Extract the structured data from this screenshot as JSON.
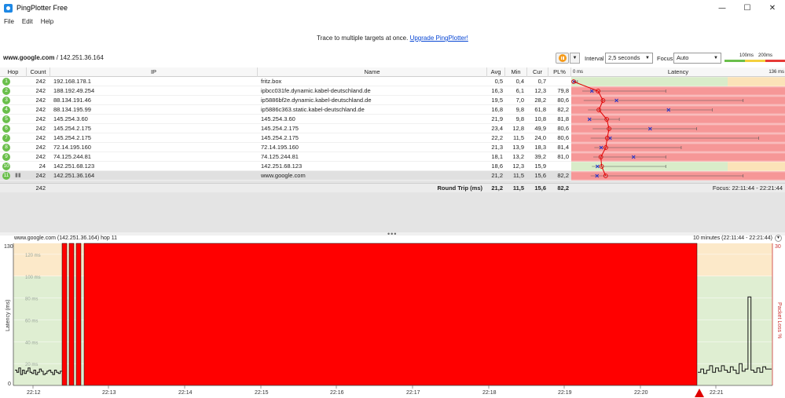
{
  "window": {
    "title": "PingPlotter Free",
    "minimize": "—",
    "maximize": "☐",
    "close": "✕"
  },
  "menu": [
    "File",
    "Edit",
    "Help"
  ],
  "banner": {
    "text": "Trace to multiple targets at once. ",
    "link": "Upgrade PingPlotter!"
  },
  "toolbar": {
    "target_host": "www.google.com",
    "target_ip": " / 142.251.36.164",
    "interval_label": "Interval",
    "interval_value": "2,5 seconds",
    "focus_label": "Focus",
    "focus_value": "Auto",
    "scale_100": "100ms",
    "scale_200": "200ms"
  },
  "colors": {
    "good": "#6abf4b",
    "warn": "#f4d03f",
    "bad": "#e53935",
    "loss_red": "#ff0000",
    "accent": "#f59b1c"
  },
  "table": {
    "headers": {
      "hop": "Hop",
      "count": "Count",
      "ip": "IP",
      "name": "Name",
      "avg": "Avg",
      "min": "Min",
      "cur": "Cur",
      "pl": "PL%",
      "latency": "Latency"
    },
    "latency_axis": {
      "start": "0 ms",
      "end": "136 ms",
      "max": 136
    },
    "rows": [
      {
        "hop": "1",
        "count": "242",
        "ip": "192.168.178.1",
        "name": "fritz.box",
        "avg": "0,5",
        "min": "0,4",
        "cur": "0,7",
        "pl": "",
        "avg_v": 0.5,
        "min_v": 0.4,
        "max_v": 3,
        "cur_v": 0.7,
        "pl_v": 0
      },
      {
        "hop": "2",
        "count": "242",
        "ip": "188.192.49.254",
        "name": "ipbcc031fe.dynamic.kabel-deutschland.de",
        "avg": "16,3",
        "min": "6,1",
        "cur": "12,3",
        "pl": "79,8",
        "avg_v": 16.3,
        "min_v": 6.1,
        "max_v": 60,
        "cur_v": 12.3,
        "pl_v": 79.8
      },
      {
        "hop": "3",
        "count": "242",
        "ip": "88.134.191.46",
        "name": "ip5886bf2e.dynamic.kabel-deutschland.de",
        "avg": "19,5",
        "min": "7,0",
        "cur": "28,2",
        "pl": "80,6",
        "avg_v": 19.5,
        "min_v": 7.0,
        "max_v": 110,
        "cur_v": 28.2,
        "pl_v": 80.6
      },
      {
        "hop": "4",
        "count": "242",
        "ip": "88.134.195.99",
        "name": "ip5886c363.static.kabel-deutschland.de",
        "avg": "16,8",
        "min": "9,8",
        "cur": "61,8",
        "pl": "82,2",
        "avg_v": 16.8,
        "min_v": 9.8,
        "max_v": 90,
        "cur_v": 61.8,
        "pl_v": 82.2
      },
      {
        "hop": "5",
        "count": "242",
        "ip": "145.254.3.60",
        "name": "145.254.3.60",
        "avg": "21,9",
        "min": "9,8",
        "cur": "10,8",
        "pl": "81,8",
        "avg_v": 21.9,
        "min_v": 9.8,
        "max_v": 30,
        "cur_v": 10.8,
        "pl_v": 81.8
      },
      {
        "hop": "6",
        "count": "242",
        "ip": "145.254.2.175",
        "name": "145.254.2.175",
        "avg": "23,4",
        "min": "12,8",
        "cur": "49,9",
        "pl": "80,6",
        "avg_v": 23.4,
        "min_v": 12.8,
        "max_v": 80,
        "cur_v": 49.9,
        "pl_v": 80.6
      },
      {
        "hop": "7",
        "count": "242",
        "ip": "145.254.2.175",
        "name": "145.254.2.175",
        "avg": "22,2",
        "min": "11,5",
        "cur": "24,0",
        "pl": "80,6",
        "avg_v": 22.2,
        "min_v": 11.5,
        "max_v": 120,
        "cur_v": 24.0,
        "pl_v": 80.6
      },
      {
        "hop": "8",
        "count": "242",
        "ip": "72.14.195.160",
        "name": "72.14.195.160",
        "avg": "21,3",
        "min": "13,9",
        "cur": "18,3",
        "pl": "81,4",
        "avg_v": 21.3,
        "min_v": 13.9,
        "max_v": 70,
        "cur_v": 18.3,
        "pl_v": 81.4
      },
      {
        "hop": "9",
        "count": "242",
        "ip": "74.125.244.81",
        "name": "74.125.244.81",
        "avg": "18,1",
        "min": "13,2",
        "cur": "39,2",
        "pl": "81,0",
        "avg_v": 18.1,
        "min_v": 13.2,
        "max_v": 60,
        "cur_v": 39.2,
        "pl_v": 81.0
      },
      {
        "hop": "10",
        "count": "24",
        "ip": "142.251.68.123",
        "name": "142.251.68.123",
        "avg": "18,6",
        "min": "12,3",
        "cur": "15,9",
        "pl": "",
        "avg_v": 18.6,
        "min_v": 12.3,
        "max_v": 60,
        "cur_v": 15.9,
        "pl_v": 0
      },
      {
        "hop": "11",
        "count": "242",
        "ip": "142.251.36.164",
        "name": "www.google.com",
        "avg": "21,2",
        "min": "11,5",
        "cur": "15,6",
        "pl": "82,2",
        "avg_v": 21.2,
        "min_v": 11.5,
        "max_v": 110,
        "cur_v": 15.6,
        "pl_v": 82.2
      }
    ],
    "summary": {
      "count": "242",
      "label": "Round Trip (ms)",
      "avg": "21,2",
      "min": "11,5",
      "cur": "15,6",
      "pl": "82,2",
      "focus": "Focus: 22:11:44 - 22:21:44"
    }
  },
  "graph": {
    "title": "www.google.com (142.251.36.164) hop 11",
    "range": "10 minutes (22:11:44 - 22:21:44)",
    "y_top": "130",
    "y_zero": "0",
    "y_right_top": "30",
    "ylabel": "Latency (ms)",
    "ylabel_right": "Packet Loss %",
    "y_grid_labels": [
      "120 ms",
      "100 ms",
      "80 ms",
      "60 ms",
      "40 ms",
      "20 ms"
    ],
    "x_ticks": [
      "22:12",
      "22:13",
      "22:14",
      "22:15",
      "22:16",
      "22:17",
      "22:18",
      "22:19",
      "22:20",
      "22:21"
    ],
    "latency_series_start": [
      14,
      12,
      16,
      10,
      14,
      11,
      13,
      16,
      12,
      11,
      14,
      10,
      12,
      15,
      13,
      10,
      11,
      13,
      14,
      12,
      10,
      14,
      12,
      11,
      13
    ],
    "latency_series_end": [
      12,
      15,
      11,
      14,
      18,
      12,
      16,
      13,
      18,
      14,
      12,
      17,
      14,
      11,
      20,
      13,
      15,
      81,
      14,
      12,
      16,
      12,
      17,
      15,
      15
    ]
  }
}
